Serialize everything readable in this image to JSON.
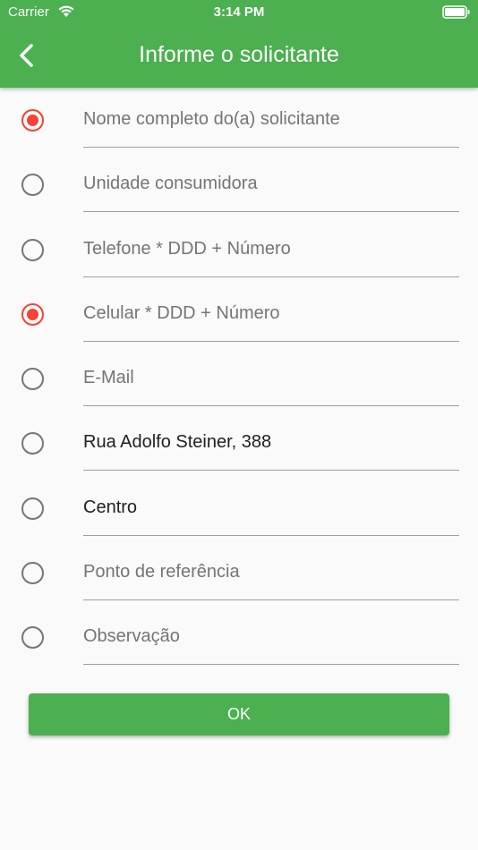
{
  "status_bar": {
    "carrier": "Carrier",
    "time": "3:14 PM"
  },
  "header": {
    "title": "Informe o solicitante",
    "back_icon": "chevron-left-icon"
  },
  "colors": {
    "primary": "#4caf50",
    "radio_selected": "#f44336"
  },
  "fields": [
    {
      "text": "Nome completo do(a) solicitante",
      "is_value": false,
      "selected": true
    },
    {
      "text": "Unidade consumidora",
      "is_value": false,
      "selected": false
    },
    {
      "text": "Telefone * DDD + Número",
      "is_value": false,
      "selected": false
    },
    {
      "text": "Celular * DDD + Número",
      "is_value": false,
      "selected": true
    },
    {
      "text": "E-Mail",
      "is_value": false,
      "selected": false
    },
    {
      "text": "Rua Adolfo Steiner, 388",
      "is_value": true,
      "selected": false
    },
    {
      "text": "Centro",
      "is_value": true,
      "selected": false
    },
    {
      "text": "Ponto de referência",
      "is_value": false,
      "selected": false
    },
    {
      "text": "Observação",
      "is_value": false,
      "selected": false
    }
  ],
  "ok_button": {
    "label": "OK"
  }
}
